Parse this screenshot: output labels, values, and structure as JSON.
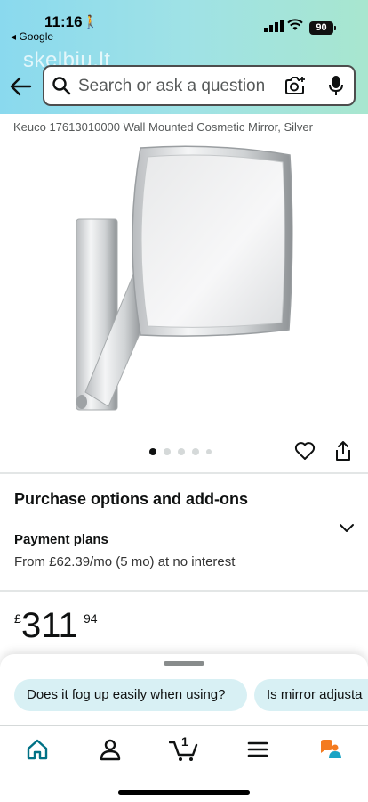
{
  "status_bar": {
    "time": "11:16",
    "back_app": "◂ Google",
    "battery": "90"
  },
  "watermark": "skelbiu.lt",
  "search": {
    "placeholder": "Search or ask a question"
  },
  "product": {
    "title": "Keuco 17613010000 Wall Mounted Cosmetic Mirror, Silver",
    "image_count": 5,
    "active_image": 1
  },
  "purchase": {
    "heading": "Purchase options and add-ons",
    "plans_label": "Payment plans",
    "plans_detail": "From £62.39/mo (5 mo) at no interest"
  },
  "price": {
    "symbol": "£",
    "whole": "311",
    "fraction": "94"
  },
  "suggestions": [
    "Does it fog up easily when using?",
    "Is mirror adjusta"
  ],
  "tabbar": {
    "cart_count": "1",
    "active_tab": "home",
    "accent_color": "#007185"
  },
  "colors": {
    "header_gradient_start": "#8ad9ee",
    "header_gradient_end": "#a8e6cf",
    "chip_background": "#d8f0f4"
  }
}
